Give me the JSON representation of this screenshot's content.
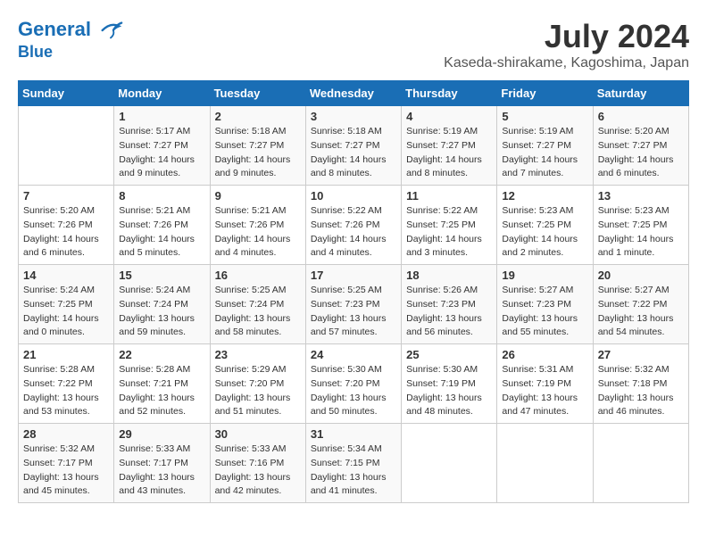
{
  "header": {
    "logo_line1": "General",
    "logo_line2": "Blue",
    "month_title": "July 2024",
    "location": "Kaseda-shirakame, Kagoshima, Japan"
  },
  "weekdays": [
    "Sunday",
    "Monday",
    "Tuesday",
    "Wednesday",
    "Thursday",
    "Friday",
    "Saturday"
  ],
  "weeks": [
    [
      {
        "day": "",
        "info": ""
      },
      {
        "day": "1",
        "info": "Sunrise: 5:17 AM\nSunset: 7:27 PM\nDaylight: 14 hours\nand 9 minutes."
      },
      {
        "day": "2",
        "info": "Sunrise: 5:18 AM\nSunset: 7:27 PM\nDaylight: 14 hours\nand 9 minutes."
      },
      {
        "day": "3",
        "info": "Sunrise: 5:18 AM\nSunset: 7:27 PM\nDaylight: 14 hours\nand 8 minutes."
      },
      {
        "day": "4",
        "info": "Sunrise: 5:19 AM\nSunset: 7:27 PM\nDaylight: 14 hours\nand 8 minutes."
      },
      {
        "day": "5",
        "info": "Sunrise: 5:19 AM\nSunset: 7:27 PM\nDaylight: 14 hours\nand 7 minutes."
      },
      {
        "day": "6",
        "info": "Sunrise: 5:20 AM\nSunset: 7:27 PM\nDaylight: 14 hours\nand 6 minutes."
      }
    ],
    [
      {
        "day": "7",
        "info": "Sunrise: 5:20 AM\nSunset: 7:26 PM\nDaylight: 14 hours\nand 6 minutes."
      },
      {
        "day": "8",
        "info": "Sunrise: 5:21 AM\nSunset: 7:26 PM\nDaylight: 14 hours\nand 5 minutes."
      },
      {
        "day": "9",
        "info": "Sunrise: 5:21 AM\nSunset: 7:26 PM\nDaylight: 14 hours\nand 4 minutes."
      },
      {
        "day": "10",
        "info": "Sunrise: 5:22 AM\nSunset: 7:26 PM\nDaylight: 14 hours\nand 4 minutes."
      },
      {
        "day": "11",
        "info": "Sunrise: 5:22 AM\nSunset: 7:25 PM\nDaylight: 14 hours\nand 3 minutes."
      },
      {
        "day": "12",
        "info": "Sunrise: 5:23 AM\nSunset: 7:25 PM\nDaylight: 14 hours\nand 2 minutes."
      },
      {
        "day": "13",
        "info": "Sunrise: 5:23 AM\nSunset: 7:25 PM\nDaylight: 14 hours\nand 1 minute."
      }
    ],
    [
      {
        "day": "14",
        "info": "Sunrise: 5:24 AM\nSunset: 7:25 PM\nDaylight: 14 hours\nand 0 minutes."
      },
      {
        "day": "15",
        "info": "Sunrise: 5:24 AM\nSunset: 7:24 PM\nDaylight: 13 hours\nand 59 minutes."
      },
      {
        "day": "16",
        "info": "Sunrise: 5:25 AM\nSunset: 7:24 PM\nDaylight: 13 hours\nand 58 minutes."
      },
      {
        "day": "17",
        "info": "Sunrise: 5:25 AM\nSunset: 7:23 PM\nDaylight: 13 hours\nand 57 minutes."
      },
      {
        "day": "18",
        "info": "Sunrise: 5:26 AM\nSunset: 7:23 PM\nDaylight: 13 hours\nand 56 minutes."
      },
      {
        "day": "19",
        "info": "Sunrise: 5:27 AM\nSunset: 7:23 PM\nDaylight: 13 hours\nand 55 minutes."
      },
      {
        "day": "20",
        "info": "Sunrise: 5:27 AM\nSunset: 7:22 PM\nDaylight: 13 hours\nand 54 minutes."
      }
    ],
    [
      {
        "day": "21",
        "info": "Sunrise: 5:28 AM\nSunset: 7:22 PM\nDaylight: 13 hours\nand 53 minutes."
      },
      {
        "day": "22",
        "info": "Sunrise: 5:28 AM\nSunset: 7:21 PM\nDaylight: 13 hours\nand 52 minutes."
      },
      {
        "day": "23",
        "info": "Sunrise: 5:29 AM\nSunset: 7:20 PM\nDaylight: 13 hours\nand 51 minutes."
      },
      {
        "day": "24",
        "info": "Sunrise: 5:30 AM\nSunset: 7:20 PM\nDaylight: 13 hours\nand 50 minutes."
      },
      {
        "day": "25",
        "info": "Sunrise: 5:30 AM\nSunset: 7:19 PM\nDaylight: 13 hours\nand 48 minutes."
      },
      {
        "day": "26",
        "info": "Sunrise: 5:31 AM\nSunset: 7:19 PM\nDaylight: 13 hours\nand 47 minutes."
      },
      {
        "day": "27",
        "info": "Sunrise: 5:32 AM\nSunset: 7:18 PM\nDaylight: 13 hours\nand 46 minutes."
      }
    ],
    [
      {
        "day": "28",
        "info": "Sunrise: 5:32 AM\nSunset: 7:17 PM\nDaylight: 13 hours\nand 45 minutes."
      },
      {
        "day": "29",
        "info": "Sunrise: 5:33 AM\nSunset: 7:17 PM\nDaylight: 13 hours\nand 43 minutes."
      },
      {
        "day": "30",
        "info": "Sunrise: 5:33 AM\nSunset: 7:16 PM\nDaylight: 13 hours\nand 42 minutes."
      },
      {
        "day": "31",
        "info": "Sunrise: 5:34 AM\nSunset: 7:15 PM\nDaylight: 13 hours\nand 41 minutes."
      },
      {
        "day": "",
        "info": ""
      },
      {
        "day": "",
        "info": ""
      },
      {
        "day": "",
        "info": ""
      }
    ]
  ]
}
